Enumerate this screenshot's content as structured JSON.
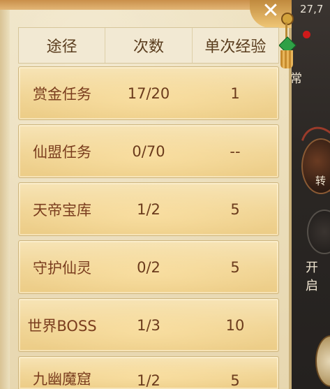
{
  "hud": {
    "coord_text": "27,7",
    "side_labels": [
      "常",
      "转",
      "开启"
    ]
  },
  "panel": {
    "close_glyph": "✕"
  },
  "table": {
    "headers": [
      "途径",
      "次数",
      "单次经验"
    ],
    "rows": [
      {
        "name": "赏金任务",
        "count": "17/20",
        "exp": "1"
      },
      {
        "name": "仙盟任务",
        "count": "0/70",
        "exp": "--"
      },
      {
        "name": "天帝宝库",
        "count": "1/2",
        "exp": "5"
      },
      {
        "name": "守护仙灵",
        "count": "0/2",
        "exp": "5"
      },
      {
        "name": "世界BOSS",
        "count": "1/3",
        "exp": "10"
      },
      {
        "name": "九幽魔窟",
        "count": "1/2",
        "exp": "5"
      }
    ]
  },
  "colors": {
    "accent": "#c08a3e",
    "row_fill": "#f1d596",
    "text": "#6b3b1c"
  }
}
